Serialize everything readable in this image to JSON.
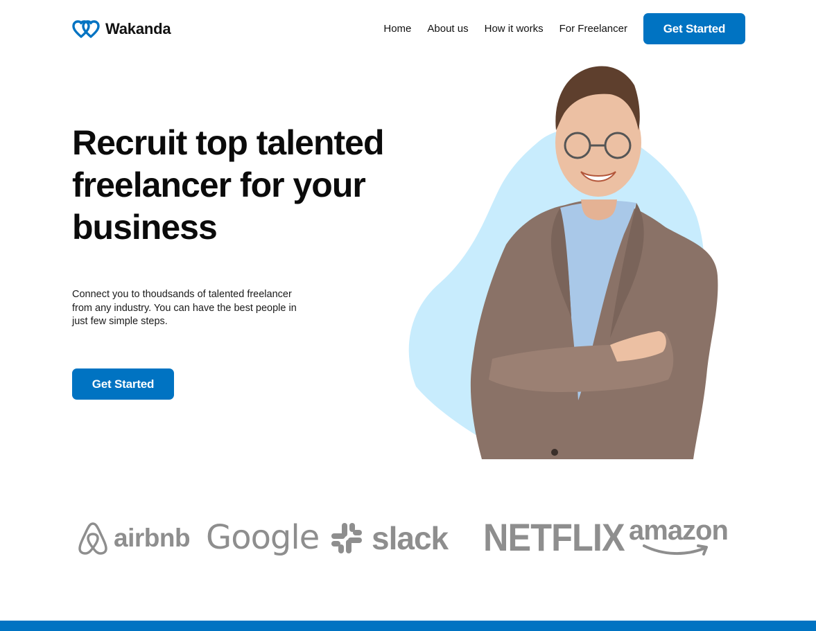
{
  "brand": {
    "name": "Wakanda",
    "logo_icon": "double-heart-icon",
    "accent_color": "#0073c2"
  },
  "nav": {
    "links": [
      "Home",
      "About us",
      "How it works",
      "For Freelancer"
    ],
    "cta_label": "Get Started"
  },
  "hero": {
    "title": "Recruit top talented freelancer for your business",
    "subtitle": "Connect you to thoudsands of talented freelancer from any industry. You can have the best people in just few simple steps.",
    "cta_label": "Get Started",
    "blob_color": "#c8ecfd"
  },
  "partners": {
    "logos": [
      "airbnb",
      "Google",
      "slack",
      "NETFLIX",
      "amazon"
    ],
    "logo_color": "#8e8e8e"
  },
  "footer": {
    "bar_color": "#0073c2"
  }
}
